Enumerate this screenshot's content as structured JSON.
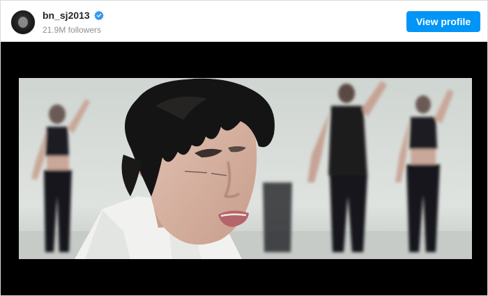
{
  "header": {
    "username": "bn_sj2013",
    "verified": true,
    "followers": "21.9M followers",
    "view_profile_label": "View profile"
  },
  "colors": {
    "accent": "#0095f6",
    "verified_badge": "#3897f0",
    "username_text": "#262626",
    "secondary_text": "#8e8e8e",
    "media_background": "#000000"
  },
  "media": {
    "type": "video-frame",
    "icons": [
      "verified-icon"
    ]
  }
}
